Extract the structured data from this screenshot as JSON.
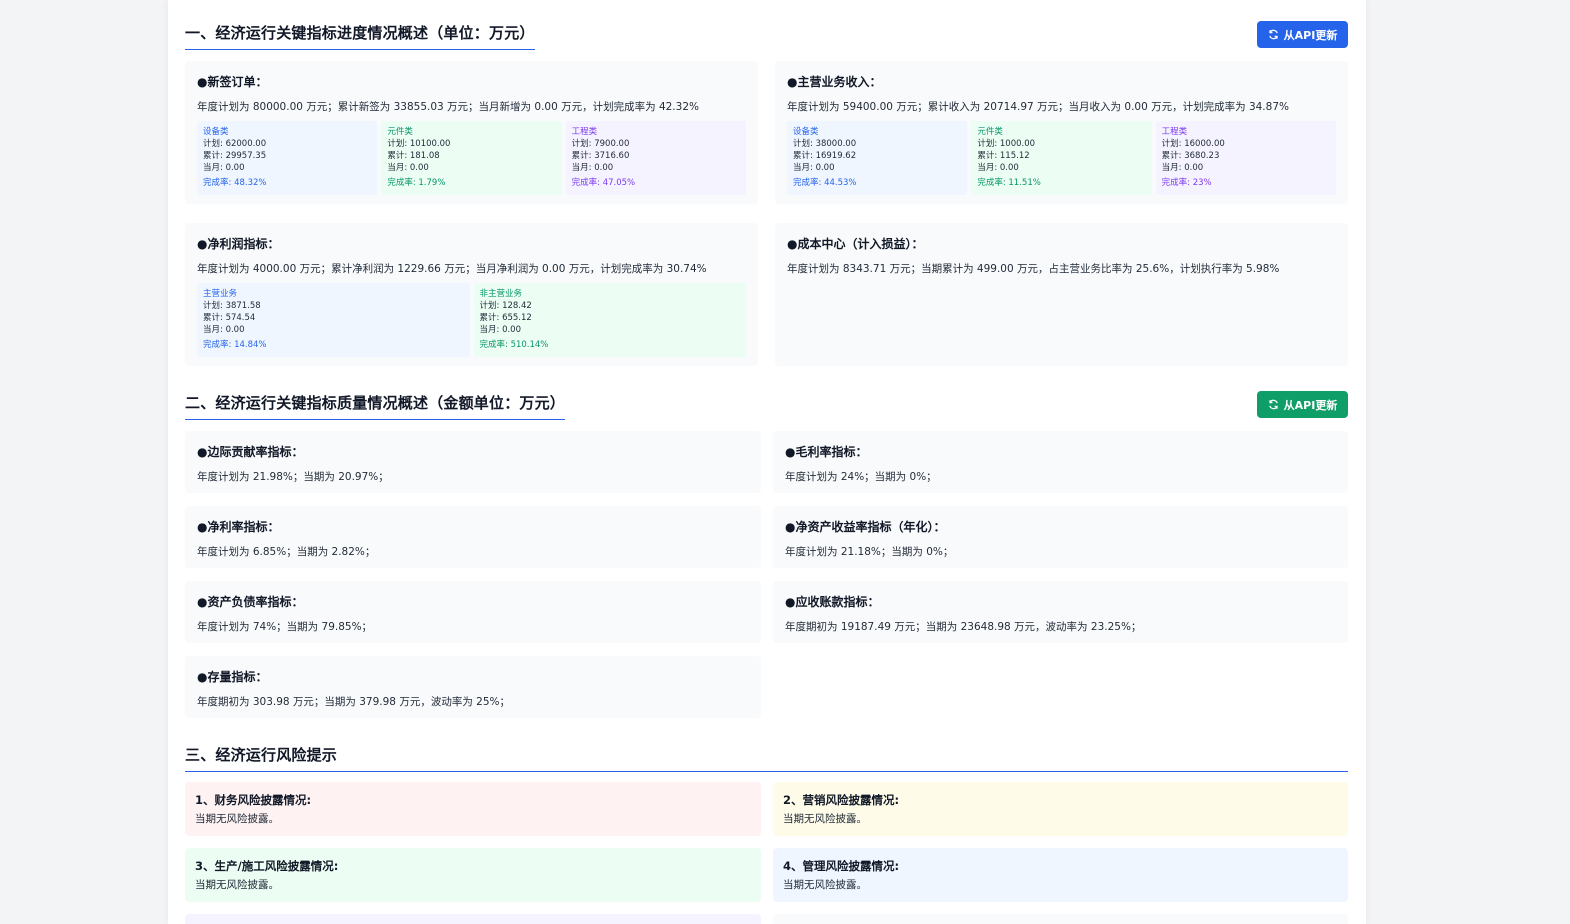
{
  "colors": {
    "accent_blue": "#2563eb",
    "accent_green": "#059669",
    "btn_blue": "#2563eb",
    "btn_green": "#0f9d68"
  },
  "section1": {
    "title": "一、经济运行关键指标进度情况概述（单位：万元）",
    "api_button": "从API更新",
    "cards": [
      {
        "title": "●新签订单：",
        "text": "年度计划为 80000.00 万元；累计新签为 33855.03 万元；当月新增为 0.00 万元，计划完成率为 42.32%",
        "subs": [
          {
            "name": "设备类",
            "plan": "计划: 62000.00",
            "cum": "累计: 29957.35",
            "month": "当月: 0.00",
            "rate": "完成率: 48.32%"
          },
          {
            "name": "元件类",
            "plan": "计划: 10100.00",
            "cum": "累计: 181.08",
            "month": "当月: 0.00",
            "rate": "完成率: 1.79%"
          },
          {
            "name": "工程类",
            "plan": "计划: 7900.00",
            "cum": "累计: 3716.60",
            "month": "当月: 0.00",
            "rate": "完成率: 47.05%"
          }
        ]
      },
      {
        "title": "●主营业务收入：",
        "text": "年度计划为 59400.00 万元；累计收入为 20714.97 万元；当月收入为 0.00 万元，计划完成率为 34.87%",
        "subs": [
          {
            "name": "设备类",
            "plan": "计划: 38000.00",
            "cum": "累计: 16919.62",
            "month": "当月: 0.00",
            "rate": "完成率: 44.53%"
          },
          {
            "name": "元件类",
            "plan": "计划: 1000.00",
            "cum": "累计: 115.12",
            "month": "当月: 0.00",
            "rate": "完成率: 11.51%"
          },
          {
            "name": "工程类",
            "plan": "计划: 16000.00",
            "cum": "累计: 3680.23",
            "month": "当月: 0.00",
            "rate": "完成率: 23%"
          }
        ]
      },
      {
        "title": "●净利润指标：",
        "text": "年度计划为 4000.00 万元；累计净利润为 1229.66 万元；当月净利润为 0.00 万元，计划完成率为 30.74%",
        "subs": [
          {
            "name": "主营业务",
            "plan": "计划: 3871.58",
            "cum": "累计: 574.54",
            "month": "当月: 0.00",
            "rate": "完成率: 14.84%"
          },
          {
            "name": "非主营业务",
            "plan": "计划: 128.42",
            "cum": "累计: 655.12",
            "month": "当月: 0.00",
            "rate": "完成率: 510.14%"
          }
        ]
      },
      {
        "title": "●成本中心（计入损益）：",
        "text": "年度计划为 8343.71 万元；当期累计为 499.00 万元，占主营业务比率为 25.6%，计划执行率为 5.98%"
      }
    ]
  },
  "section2": {
    "title": "二、经济运行关键指标质量情况概述（金额单位：万元）",
    "api_button": "从API更新",
    "cards": [
      {
        "title": "●边际贡献率指标：",
        "text": "年度计划为 21.98%；当期为 20.97%；"
      },
      {
        "title": "●毛利率指标：",
        "text": "年度计划为 24%；当期为 0%；"
      },
      {
        "title": "●净利率指标：",
        "text": "年度计划为 6.85%；当期为 2.82%；"
      },
      {
        "title": "●净资产收益率指标（年化）：",
        "text": "年度计划为 21.18%；当期为 0%；"
      },
      {
        "title": "●资产负债率指标：",
        "text": "年度计划为 74%；当期为 79.85%；"
      },
      {
        "title": "●应收账款指标：",
        "text": "年度期初为 19187.49 万元；当期为 23648.98 万元，波动率为 23.25%；"
      },
      {
        "title": "●存量指标：",
        "text": "年度期初为 303.98 万元；当期为 379.98 万元，波动率为 25%；"
      }
    ]
  },
  "section3": {
    "title": "三、经济运行风险提示",
    "risks": [
      {
        "title": "1、财务风险披露情况:",
        "text": "当期无风险披露。"
      },
      {
        "title": "2、营销风险披露情况:",
        "text": "当期无风险披露。"
      },
      {
        "title": "3、生产/施工风险披露情况:",
        "text": "当期无风险披露。"
      },
      {
        "title": "4、管理风险披露情况:",
        "text": "当期无风险披露。"
      }
    ]
  }
}
